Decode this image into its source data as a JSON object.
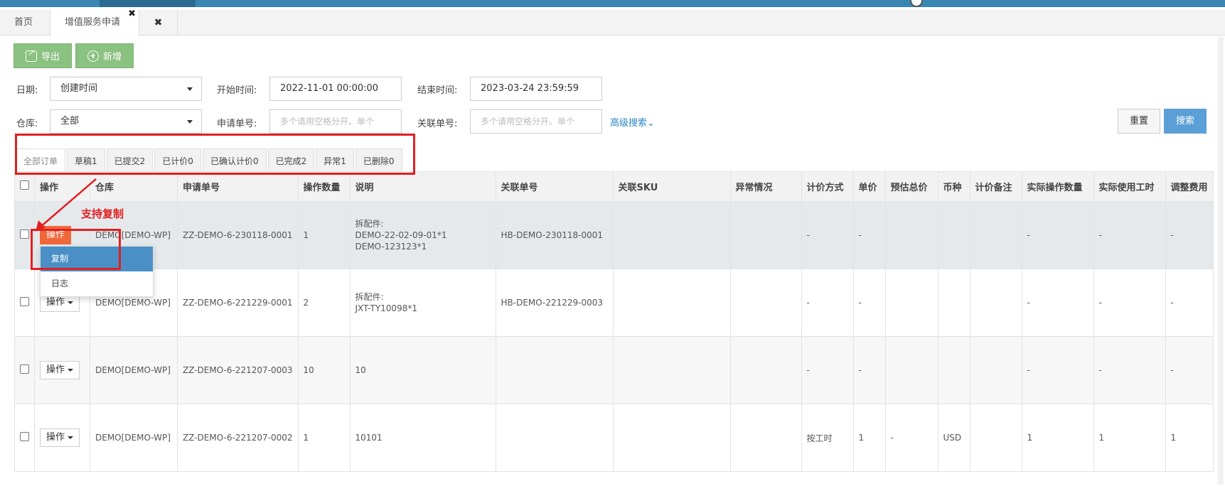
{
  "tabs": {
    "home": "首页",
    "active": "增值服务申请",
    "active_close": "✖",
    "close_all": "✖"
  },
  "toolbar": {
    "export_label": "导出",
    "add_label": "新增"
  },
  "filters": {
    "date_label": "日期:",
    "date_type": "创建时间",
    "start_label": "开始时间:",
    "start_value": "2022-11-01 00:00:00",
    "end_label": "结束时间:",
    "end_value": "2023-03-24 23:59:59",
    "warehouse_label": "仓库:",
    "warehouse_value": "全部",
    "apply_no_label": "申请单号:",
    "apply_no_placeholder": "多个请用空格分开。单个",
    "related_no_label": "关联单号:",
    "related_no_placeholder": "多个请用空格分开。单个",
    "advanced": "高级搜索",
    "reset": "重置",
    "search": "搜索"
  },
  "status_tabs": [
    "全部订单",
    "草稿1",
    "已提交2",
    "已计价0",
    "已确认计价0",
    "已完成2",
    "异常1",
    "已删除0"
  ],
  "annotation": "支持复制",
  "columns": [
    "操作",
    "仓库",
    "申请单号",
    "操作数量",
    "说明",
    "关联单号",
    "关联SKU",
    "异常情况",
    "计价方式",
    "单价",
    "预估总价",
    "币种",
    "计价备注",
    "实际操作数量",
    "实际使用工时",
    "调整费用"
  ],
  "rows": [
    {
      "op": "操作",
      "warehouse": "DEMO[DEMO-WP]",
      "apply_no": "ZZ-DEMO-6-230118-0001",
      "qty": "1",
      "desc1": "拆配件:",
      "desc2": "DEMO-22-02-09-01*1",
      "desc3": "DEMO-123123*1",
      "related": "HB-DEMO-230118-0001",
      "sku": "",
      "abn": "",
      "method": "-",
      "price": "-",
      "total": "",
      "currency": "",
      "remark": "",
      "act_qty": "-",
      "act_hours": "-",
      "adj": "-"
    },
    {
      "op": "操作",
      "warehouse": "DEMO[DEMO-WP]",
      "apply_no": "ZZ-DEMO-6-221229-0001",
      "qty": "2",
      "desc1": "拆配件:",
      "desc2": "JXT-TY10098*1",
      "desc3": "",
      "related": "HB-DEMO-221229-0003",
      "sku": "",
      "abn": "",
      "method": "-",
      "price": "-",
      "total": "",
      "currency": "",
      "remark": "",
      "act_qty": "-",
      "act_hours": "-",
      "adj": "-"
    },
    {
      "op": "操作",
      "warehouse": "DEMO[DEMO-WP]",
      "apply_no": "ZZ-DEMO-6-221207-0003",
      "qty": "10",
      "desc1": "10",
      "desc2": "",
      "desc3": "",
      "related": "",
      "sku": "",
      "abn": "",
      "method": "-",
      "price": "-",
      "total": "",
      "currency": "",
      "remark": "",
      "act_qty": "-",
      "act_hours": "-",
      "adj": "-"
    },
    {
      "op": "操作",
      "warehouse": "DEMO[DEMO-WP]",
      "apply_no": "ZZ-DEMO-6-221207-0002",
      "qty": "1",
      "desc1": "10101",
      "desc2": "",
      "desc3": "",
      "related": "",
      "sku": "",
      "abn": "",
      "method": "按工时",
      "price": "1",
      "total": "-",
      "currency": "USD",
      "remark": "",
      "act_qty": "1",
      "act_hours": "1",
      "adj": "1"
    }
  ],
  "dropdown": {
    "copy": "复制",
    "log": "日志"
  }
}
